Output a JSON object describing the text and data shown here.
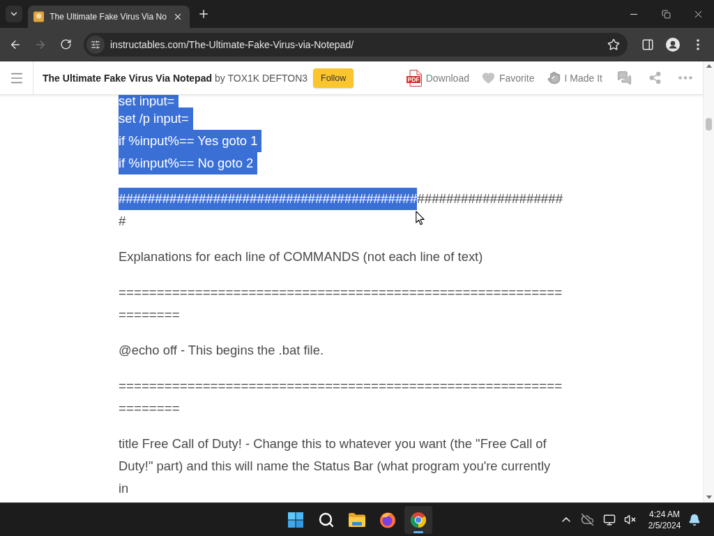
{
  "window": {
    "tabs": [
      {
        "title": "The Ultimate Fake Virus Via No",
        "selected": true
      }
    ],
    "forward_disabled": true,
    "address": "instructables.com/The-Ultimate-Fake-Virus-via-Notepad/"
  },
  "site_header": {
    "title": "The Ultimate Fake Virus Via Notepad",
    "byline": "by TOX1K DEFTON3",
    "follow": "Follow",
    "actions": [
      {
        "kind": "download",
        "label": "Download",
        "icon_text": "PDF"
      },
      {
        "kind": "favorite",
        "label": "Favorite"
      },
      {
        "kind": "made_it",
        "label": "I Made It"
      }
    ]
  },
  "article": {
    "blocks": [
      {
        "kind": "lines",
        "lines": [
          {
            "text": "set input=",
            "selected": true
          },
          {
            "text": "set /p input=",
            "selected": true
          },
          {
            "text": "if %input%== Yes goto 1",
            "selected": true
          },
          {
            "text": "if %input%== No goto 2",
            "selected": true
          }
        ]
      },
      {
        "kind": "rule",
        "segments": [
          {
            "text": "#########################################",
            "selected": true
          },
          {
            "text": "#####################",
            "selected": false
          }
        ]
      },
      {
        "kind": "text",
        "text": "Explanations for each line of COMMANDS (not each line of text)",
        "selected": false
      },
      {
        "kind": "rule",
        "segments": [
          {
            "text": "==================================================================",
            "selected": false
          }
        ]
      },
      {
        "kind": "text",
        "text": "@echo off - This begins the .bat file.",
        "selected": false
      },
      {
        "kind": "rule",
        "segments": [
          {
            "text": "==================================================================",
            "selected": false
          }
        ]
      },
      {
        "kind": "text",
        "text": "title Free Call of Duty! - Change this to whatever you want (the \"Free Call of Duty!\" part) and this will name the Status Bar (what program you're currently in",
        "selected": false
      }
    ]
  },
  "taskbar": {
    "apps": [
      {
        "kind": "start",
        "active": false
      },
      {
        "kind": "search",
        "active": false
      },
      {
        "kind": "folder",
        "active": false
      },
      {
        "kind": "fox_browser",
        "active": false
      },
      {
        "kind": "browser",
        "active": true
      }
    ],
    "time": "4:24 AM",
    "date": "2/5/2024"
  }
}
